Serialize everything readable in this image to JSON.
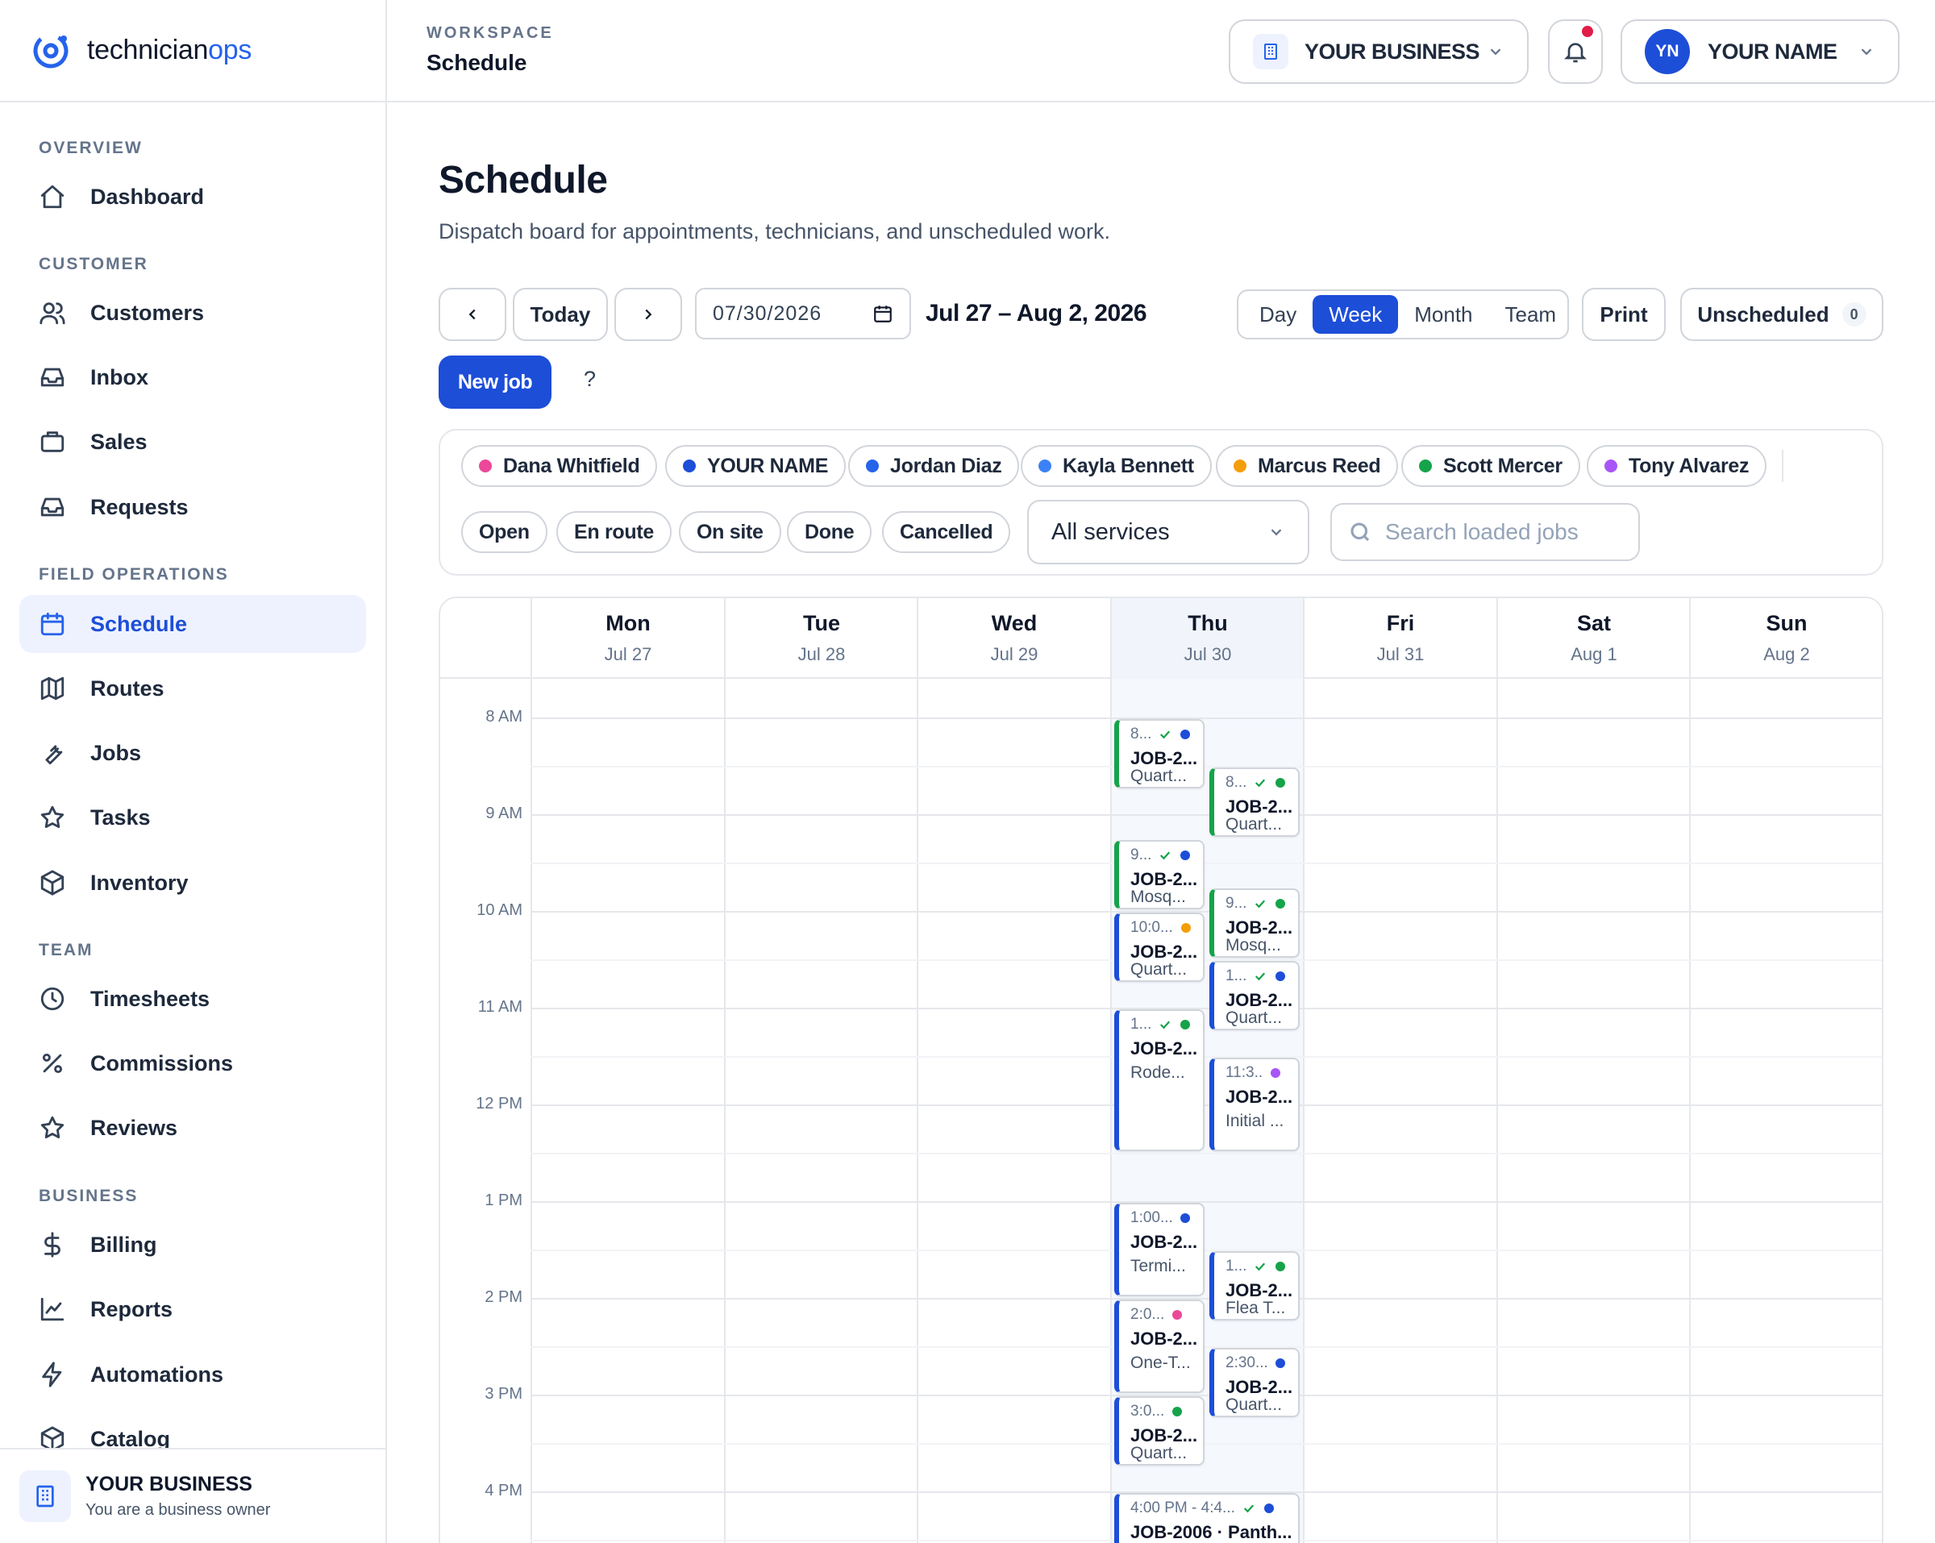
{
  "brand": {
    "name_a": "technician",
    "name_b": "ops"
  },
  "sidebar": {
    "sections": {
      "overview": "OVERVIEW",
      "customer": "CUSTOMER",
      "field": "FIELD OPERATIONS",
      "team": "TEAM",
      "business": "BUSINESS"
    },
    "items": {
      "dashboard": "Dashboard",
      "customers": "Customers",
      "inbox": "Inbox",
      "sales": "Sales",
      "requests": "Requests",
      "schedule": "Schedule",
      "routes": "Routes",
      "jobs": "Jobs",
      "tasks": "Tasks",
      "inventory": "Inventory",
      "timesheets": "Timesheets",
      "commissions": "Commissions",
      "reviews": "Reviews",
      "billing": "Billing",
      "reports": "Reports",
      "automations": "Automations",
      "catalog": "Catalog"
    },
    "footer": {
      "name": "YOUR BUSINESS",
      "role": "You are a business owner"
    }
  },
  "header": {
    "workspace_label": "WORKSPACE",
    "workspace_title": "Schedule",
    "business_selector": "YOUR BUSINESS",
    "user_initials": "YN",
    "user_name": "YOUR NAME"
  },
  "page": {
    "title": "Schedule",
    "subtitle": "Dispatch board for appointments, technicians, and unscheduled work."
  },
  "toolbar": {
    "today": "Today",
    "date_value": "07/30/2026",
    "range": "Jul 27 – Aug 2, 2026",
    "views": [
      "Day",
      "Week",
      "Month",
      "Team"
    ],
    "active_view": "Week",
    "print": "Print",
    "unscheduled": "Unscheduled",
    "unscheduled_count": "0",
    "new_job": "New job",
    "help": "?"
  },
  "filters": {
    "technicians": [
      {
        "name": "Dana Whitfield",
        "color": "#ec4899"
      },
      {
        "name": "YOUR NAME",
        "color": "#1d4ed8"
      },
      {
        "name": "Jordan Diaz",
        "color": "#2563eb"
      },
      {
        "name": "Kayla Bennett",
        "color": "#3b82f6"
      },
      {
        "name": "Marcus Reed",
        "color": "#f59e0b"
      },
      {
        "name": "Scott Mercer",
        "color": "#16a34a"
      },
      {
        "name": "Tony Alvarez",
        "color": "#a855f7"
      }
    ],
    "statuses": [
      "Open",
      "En route",
      "On site",
      "Done",
      "Cancelled"
    ],
    "service_select": "All services",
    "search_placeholder": "Search loaded jobs"
  },
  "calendar": {
    "days": [
      {
        "name": "Mon",
        "date": "Jul 27"
      },
      {
        "name": "Tue",
        "date": "Jul 28"
      },
      {
        "name": "Wed",
        "date": "Jul 29"
      },
      {
        "name": "Thu",
        "date": "Jul 30"
      },
      {
        "name": "Fri",
        "date": "Jul 31"
      },
      {
        "name": "Sat",
        "date": "Aug 1"
      },
      {
        "name": "Sun",
        "date": "Aug 2"
      }
    ],
    "hours": [
      "8 AM",
      "9 AM",
      "10 AM",
      "11 AM",
      "12 PM",
      "1 PM",
      "2 PM",
      "3 PM",
      "4 PM"
    ],
    "events": [
      {
        "time": "8...",
        "job": "JOB-2...",
        "service": "Quart...",
        "done": true,
        "dot": "#1d4ed8"
      },
      {
        "time": "8...",
        "job": "JOB-2...",
        "service": "Quart...",
        "done": true,
        "dot": "#16a34a"
      },
      {
        "time": "9...",
        "job": "JOB-2...",
        "service": "Mosq...",
        "done": true,
        "dot": "#1d4ed8"
      },
      {
        "time": "10:0...",
        "job": "JOB-2...",
        "service": "Quart...",
        "done": false,
        "dot": "#f59e0b"
      },
      {
        "time": "9...",
        "job": "JOB-2...",
        "service": "Mosq...",
        "done": true,
        "dot": "#16a34a"
      },
      {
        "time": "1...",
        "job": "JOB-2...",
        "service": "Quart...",
        "done": true,
        "dot": "#1d4ed8"
      },
      {
        "time": "1...",
        "job": "JOB-2...",
        "service": "Rode...",
        "done": true,
        "dot": "#16a34a"
      },
      {
        "time": "11:3...",
        "job": "JOB-2...",
        "service": "Initial ...",
        "done": false,
        "dot": "#a855f7"
      },
      {
        "time": "1:00...",
        "job": "JOB-2...",
        "service": "Termi...",
        "done": false,
        "dot": "#1d4ed8"
      },
      {
        "time": "1...",
        "job": "JOB-2...",
        "service": "Flea T...",
        "done": true,
        "dot": "#16a34a"
      },
      {
        "time": "2:0...",
        "job": "JOB-2...",
        "service": "One-T...",
        "done": false,
        "dot": "#ec4899"
      },
      {
        "time": "2:30...",
        "job": "JOB-2...",
        "service": "Quart...",
        "done": false,
        "dot": "#1d4ed8"
      },
      {
        "time": "3:0...",
        "job": "JOB-2...",
        "service": "Quart...",
        "done": false,
        "dot": "#16a34a"
      },
      {
        "time": "4:00 PM - 4:4...",
        "job": "JOB-2006 · Panth...",
        "service": "",
        "done": true,
        "dot": "#1d4ed8"
      }
    ]
  }
}
